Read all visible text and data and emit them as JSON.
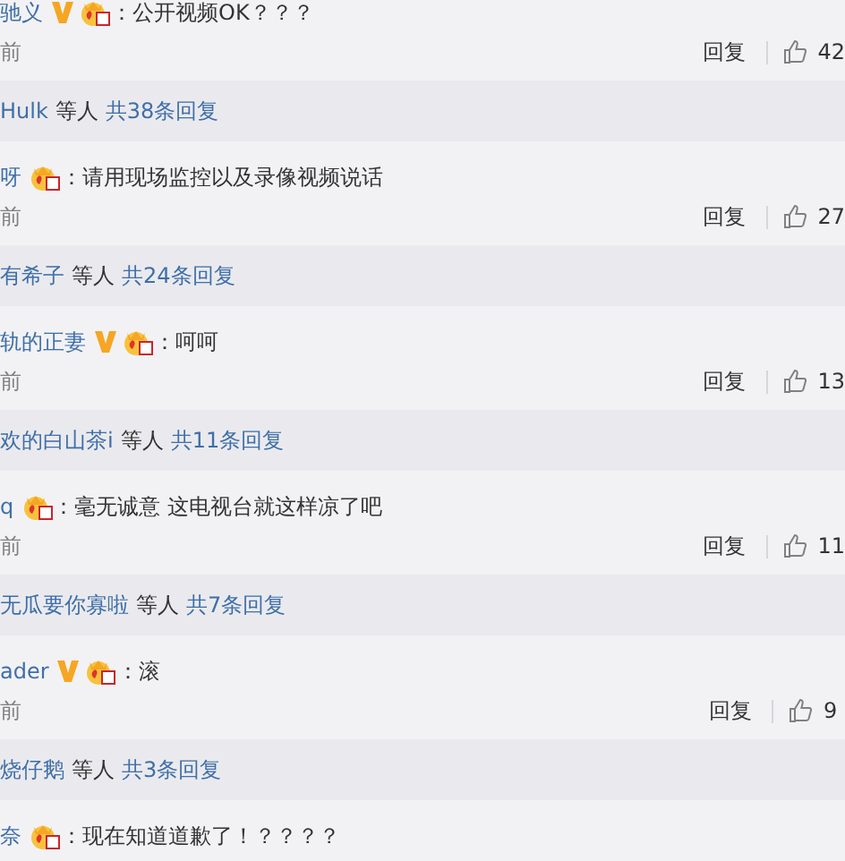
{
  "threads": [
    {
      "name": "驰义",
      "verified": true,
      "comment": "：公开视频OK？？？",
      "time": "前",
      "reply": "回复",
      "likes": "42",
      "summary": {
        "user": "Hulk",
        "suffix": "等人",
        "count": "共38条回复"
      }
    },
    {
      "name": "呀",
      "verified": false,
      "comment": "：请用现场监控以及录像视频说话",
      "time": "前",
      "reply": "回复",
      "likes": "27",
      "summary": {
        "user": "有希子",
        "suffix": "等人",
        "count": "共24条回复"
      }
    },
    {
      "name": "轨的正妻",
      "verified": true,
      "comment": "：呵呵",
      "time": "前",
      "reply": "回复",
      "likes": "13",
      "summary": {
        "user": "欢的白山茶i",
        "suffix": "等人",
        "count": "共11条回复"
      }
    },
    {
      "name": "q",
      "verified": false,
      "comment": "：毫无诚意 这电视台就这样凉了吧",
      "time": "前",
      "reply": "回复",
      "likes": "11",
      "summary": {
        "user": "无瓜要你寡啦",
        "suffix": "等人",
        "count": "共7条回复"
      }
    },
    {
      "name": "ader",
      "verified": true,
      "comment": "：滚",
      "time": "前",
      "reply": "回复",
      "likes": "9",
      "summary": {
        "user": "烧仔鹅",
        "suffix": "等人",
        "count": "共3条回复"
      }
    },
    {
      "name": "奈",
      "verified": false,
      "comment": "：现在知道道歉了！？？？？"
    }
  ]
}
